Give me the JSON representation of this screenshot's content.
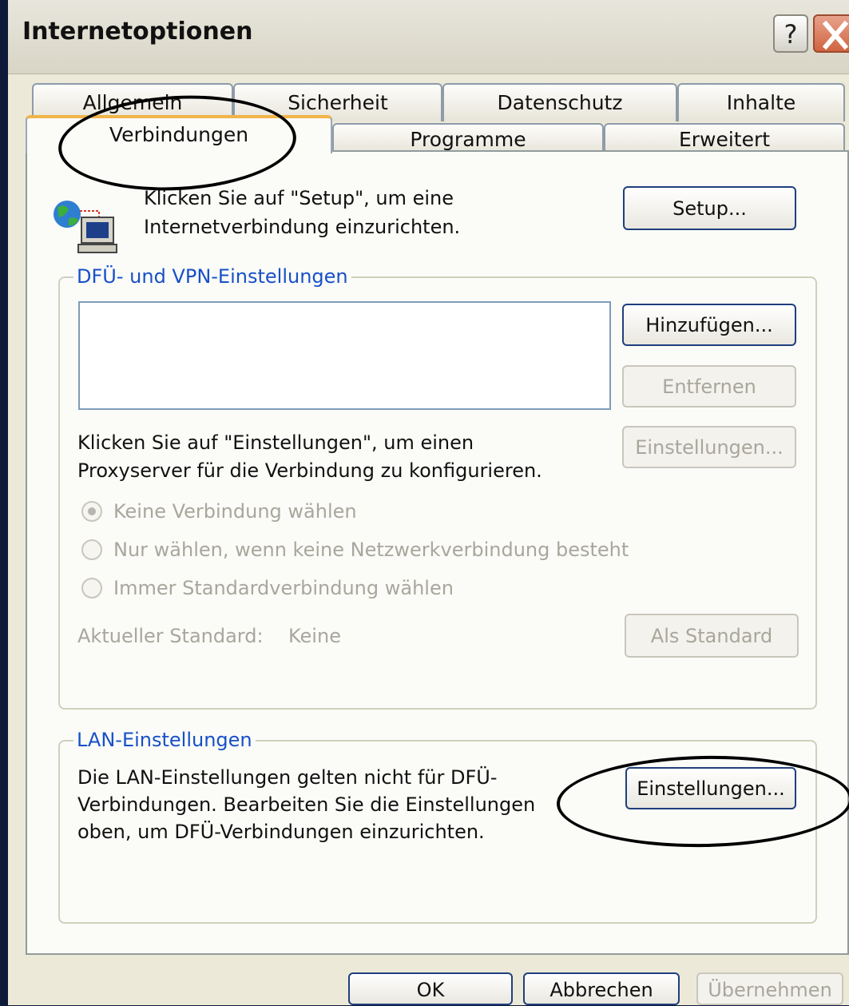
{
  "window": {
    "title": "Internetoptionen",
    "help_label": "?"
  },
  "tabs": {
    "row1": [
      "Allgemein",
      "Sicherheit",
      "Datenschutz",
      "Inhalte"
    ],
    "row2": [
      "Verbindungen",
      "Programme",
      "Erweitert"
    ],
    "active": "Verbindungen"
  },
  "setup": {
    "text_line1": "Klicken Sie auf \"Setup\", um eine",
    "text_line2": "Internetverbindung einzurichten.",
    "button": "Setup...",
    "icon": "network-computer-icon"
  },
  "dialup": {
    "group_label": "DFÜ- und VPN-Einstellungen",
    "add_button": "Hinzufügen...",
    "remove_button": "Entfernen",
    "settings_button": "Einstellungen...",
    "proxy_text_line1": "Klicken Sie auf \"Einstellungen\", um einen",
    "proxy_text_line2": "Proxyserver für die Verbindung zu konfigurieren.",
    "radio_options": [
      "Keine Verbindung wählen",
      "Nur wählen, wenn keine Netzwerkverbindung besteht",
      "Immer Standardverbindung wählen"
    ],
    "selected_option": 0,
    "current_default_label": "Aktueller Standard:",
    "current_default_value": "Keine",
    "set_default_button": "Als Standard"
  },
  "lan": {
    "group_label": "LAN-Einstellungen",
    "text_line1": "Die LAN-Einstellungen gelten nicht für DFÜ-",
    "text_line2": "Verbindungen. Bearbeiten Sie die Einstellungen",
    "text_line3": "oben, um DFÜ-Verbindungen einzurichten.",
    "settings_button": "Einstellungen..."
  },
  "footer": {
    "ok": "OK",
    "cancel": "Abbrechen",
    "apply": "Übernehmen"
  },
  "colors": {
    "group_label": "#1750c8",
    "active_tab_accent": "#f0b44a",
    "disabled_text": "#a9a79c"
  }
}
